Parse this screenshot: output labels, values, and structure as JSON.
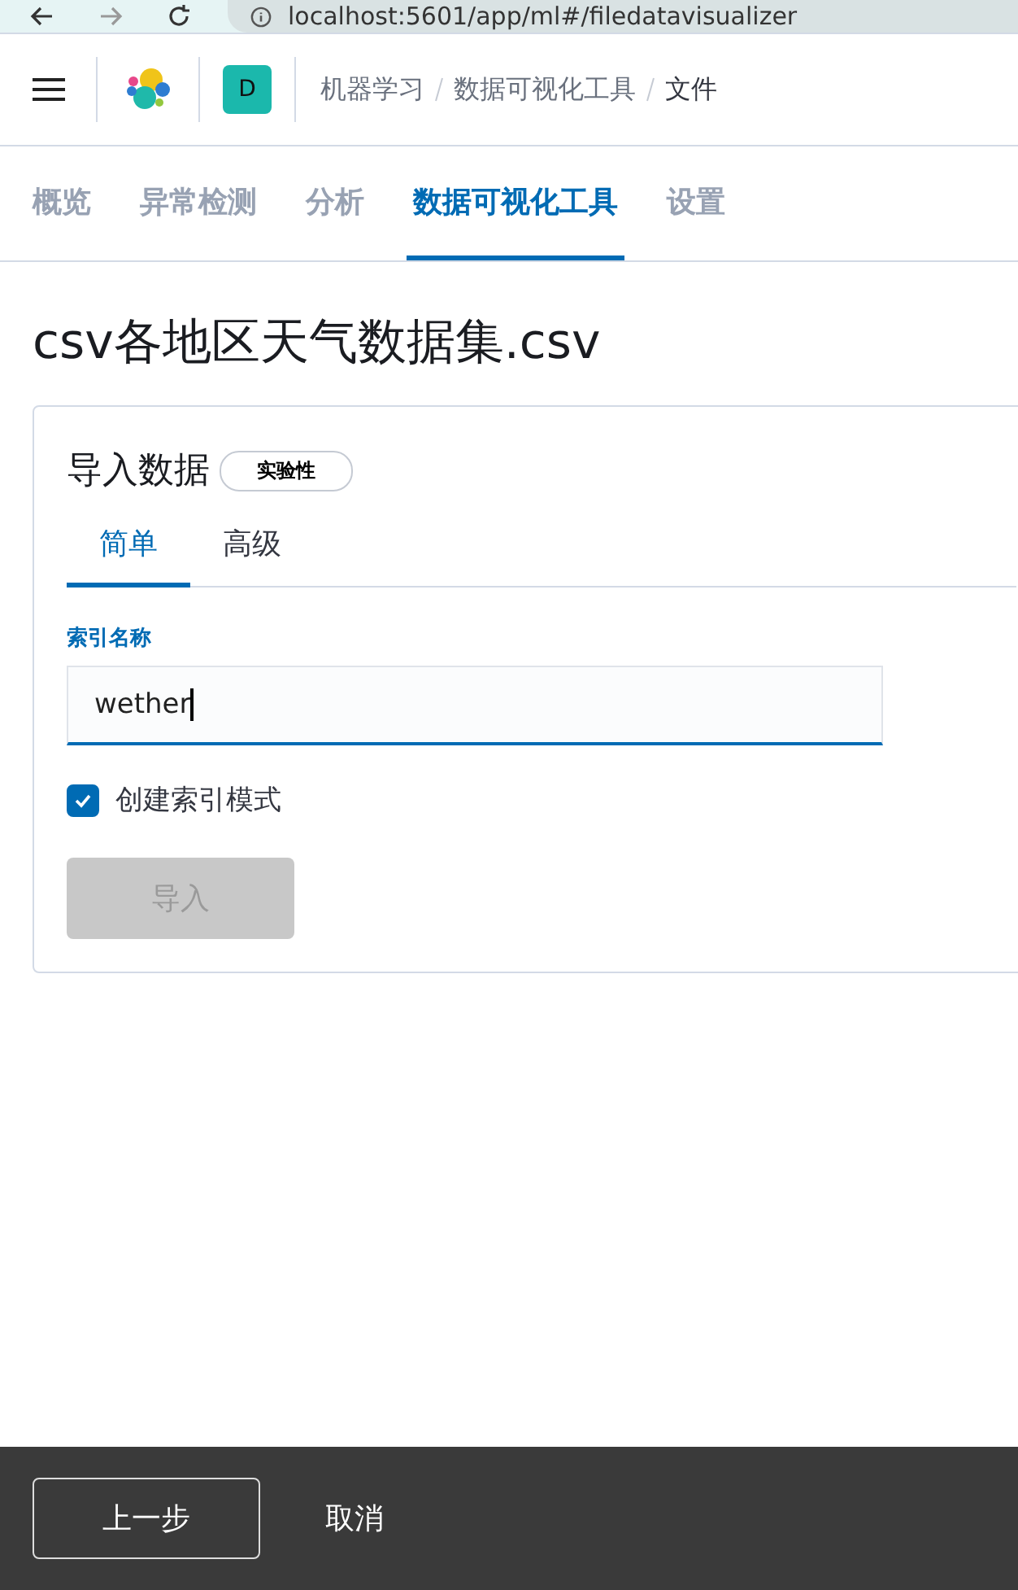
{
  "browser": {
    "url": "localhost:5601/app/ml#/filedatavisualizer"
  },
  "header": {
    "space_initial": "D",
    "breadcrumbs": [
      "机器学习",
      "数据可视化工具",
      "文件"
    ]
  },
  "tabs": [
    {
      "label": "概览",
      "selected": false
    },
    {
      "label": "异常检测",
      "selected": false
    },
    {
      "label": "分析",
      "selected": false
    },
    {
      "label": "数据可视化工具",
      "selected": true
    },
    {
      "label": "设置",
      "selected": false
    }
  ],
  "page_title": "csv各地区天气数据集.csv",
  "import_panel": {
    "title": "导入数据",
    "badge": "实验性",
    "tabs": [
      {
        "label": "简单",
        "selected": true
      },
      {
        "label": "高级",
        "selected": false
      }
    ],
    "index_name_label": "索引名称",
    "index_name_value": "wether",
    "create_index_pattern": {
      "label": "创建索引模式",
      "checked": true
    },
    "import_button": {
      "label": "导入",
      "disabled": true
    }
  },
  "footer": {
    "back_button": "上一步",
    "cancel_button": "取消"
  }
}
